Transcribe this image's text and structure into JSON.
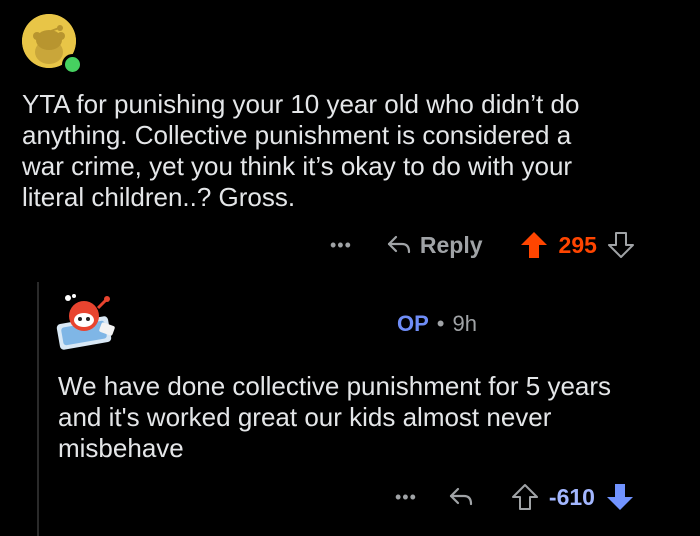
{
  "comment1": {
    "text": "YTA for punishing your 10 year old who didn’t do\nanything. Collective punishment is considered a\nwar crime, yet you think it’s okay to do with your\nliteral children..? Gross.",
    "actions": {
      "more": "•••",
      "reply_label": "Reply",
      "score": "295"
    },
    "colors": {
      "upvote": "#ff4500",
      "avatar": "#e8c547",
      "online": "#46d160"
    }
  },
  "comment2": {
    "op_label": "OP",
    "separator": "•",
    "age": "9h",
    "text": "We have done collective punishment for 5 years\nand it's worked great our kids almost never\nmisbehave",
    "actions": {
      "more": "•••",
      "score": "-610"
    },
    "colors": {
      "downvote": "#a3b7ff",
      "op": "#6f8df7"
    }
  }
}
